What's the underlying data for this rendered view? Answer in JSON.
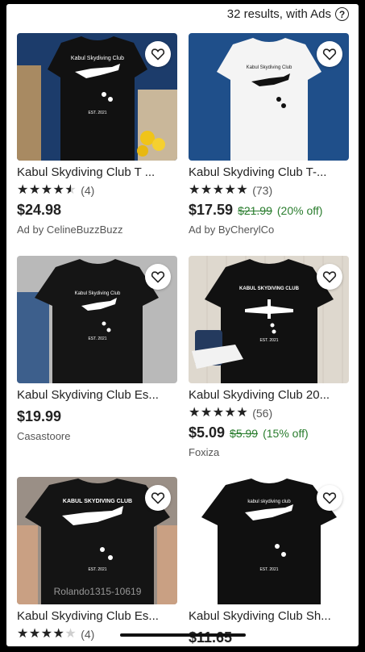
{
  "header": {
    "results_text": "32 results, with Ads",
    "help_glyph": "?"
  },
  "listings": [
    {
      "title": "Kabul Skydiving Club T ...",
      "stars": "★★★★★",
      "rating_count": "(4)",
      "price": "$24.98",
      "original_price": "",
      "discount": "",
      "seller": "Ad by CelineBuzzBuzz",
      "shirt_color": "#111111",
      "shirt_text": "Kabul Skydiving Club",
      "est": "EST. 2021"
    },
    {
      "title": "Kabul Skydiving Club T-...",
      "stars": "★★★★★",
      "rating_count": "(73)",
      "price": "$17.59",
      "original_price": "$21.99",
      "discount": "(20% off)",
      "seller": "Ad by ByCherylCo",
      "shirt_color": "#f4f4f4",
      "shirt_text": "Kabul Skydiving Club",
      "est": ""
    },
    {
      "title": "Kabul Skydiving Club Es...",
      "stars": "",
      "rating_count": "",
      "price": "$19.99",
      "original_price": "",
      "discount": "",
      "seller": "Casastoore",
      "shirt_color": "#151515",
      "shirt_text": "Kabul Skydiving Club",
      "est": "EST. 2021"
    },
    {
      "title": "Kabul Skydiving Club 20...",
      "stars": "★★★★★",
      "rating_count": "(56)",
      "price": "$5.09",
      "original_price": "$5.99",
      "discount": "(15% off)",
      "seller": "Foxiza",
      "shirt_color": "#111111",
      "shirt_text": "KABUL SKYDIVING CLUB",
      "est": "EST. 2021"
    },
    {
      "title": "Kabul Skydiving Club Es...",
      "stars": "★★★★★",
      "rating_count": "(4)",
      "price": "",
      "original_price": "",
      "discount": "",
      "seller": "",
      "shirt_color": "#141414",
      "shirt_text": "KABUL SKYDIVING CLUB",
      "est": "EST. 2021",
      "watermark": "Rolando1315-10619"
    },
    {
      "title": "Kabul Skydiving Club Sh...",
      "stars": "",
      "rating_count": "",
      "price": "$11.65",
      "original_price": "",
      "discount": "",
      "seller": "",
      "shirt_color": "#101010",
      "shirt_text": "kabul skydiving club",
      "est": "EST. 2021"
    }
  ],
  "ratings": [
    4.5,
    5,
    null,
    5,
    4,
    null
  ],
  "colors": {
    "sale_green": "#2a7d2e",
    "text": "#222222",
    "muted": "#555555"
  }
}
